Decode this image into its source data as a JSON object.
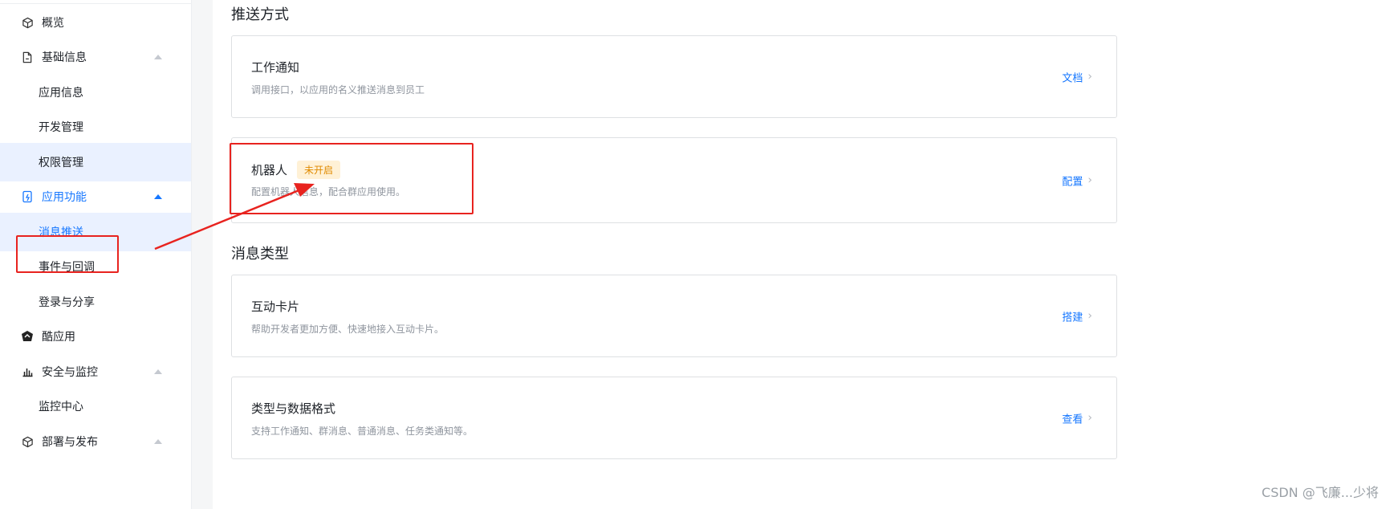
{
  "sidebar": {
    "items": [
      {
        "label": "概览",
        "type": "group",
        "icon": "cube-icon"
      },
      {
        "label": "基础信息",
        "type": "group",
        "icon": "document-icon"
      },
      {
        "label": "应用信息",
        "type": "child"
      },
      {
        "label": "开发管理",
        "type": "child"
      },
      {
        "label": "权限管理",
        "type": "child"
      },
      {
        "label": "应用功能",
        "type": "group",
        "icon": "app-function-icon"
      },
      {
        "label": "消息推送",
        "type": "child"
      },
      {
        "label": "事件与回调",
        "type": "child"
      },
      {
        "label": "登录与分享",
        "type": "child"
      },
      {
        "label": "酷应用",
        "type": "group",
        "icon": "cool-app-icon"
      },
      {
        "label": "安全与监控",
        "type": "group",
        "icon": "bar-chart-icon"
      },
      {
        "label": "监控中心",
        "type": "child"
      },
      {
        "label": "部署与发布",
        "type": "group",
        "icon": "cube-icon"
      }
    ]
  },
  "push_methods": {
    "title": "推送方式",
    "cards": [
      {
        "title": "工作通知",
        "desc": "调用接口，以应用的名义推送消息到员工",
        "link": "文档"
      },
      {
        "title": "机器人",
        "badge": "未开启",
        "desc": "配置机器人信息，配合群应用使用。",
        "link": "配置"
      }
    ]
  },
  "message_types": {
    "title": "消息类型",
    "cards": [
      {
        "title": "互动卡片",
        "desc": "帮助开发者更加方便、快速地接入互动卡片。",
        "link": "搭建"
      },
      {
        "title": "类型与数据格式",
        "desc": "支持工作通知、群消息、普通消息、任务类通知等。",
        "link": "查看"
      }
    ]
  },
  "chevron": "›",
  "watermark": "CSDN @飞廉...少将",
  "colors": {
    "accent": "#1677ff",
    "annotation": "#e8231f",
    "badge_bg": "#fff1d6",
    "badge_text": "#e08a00"
  }
}
